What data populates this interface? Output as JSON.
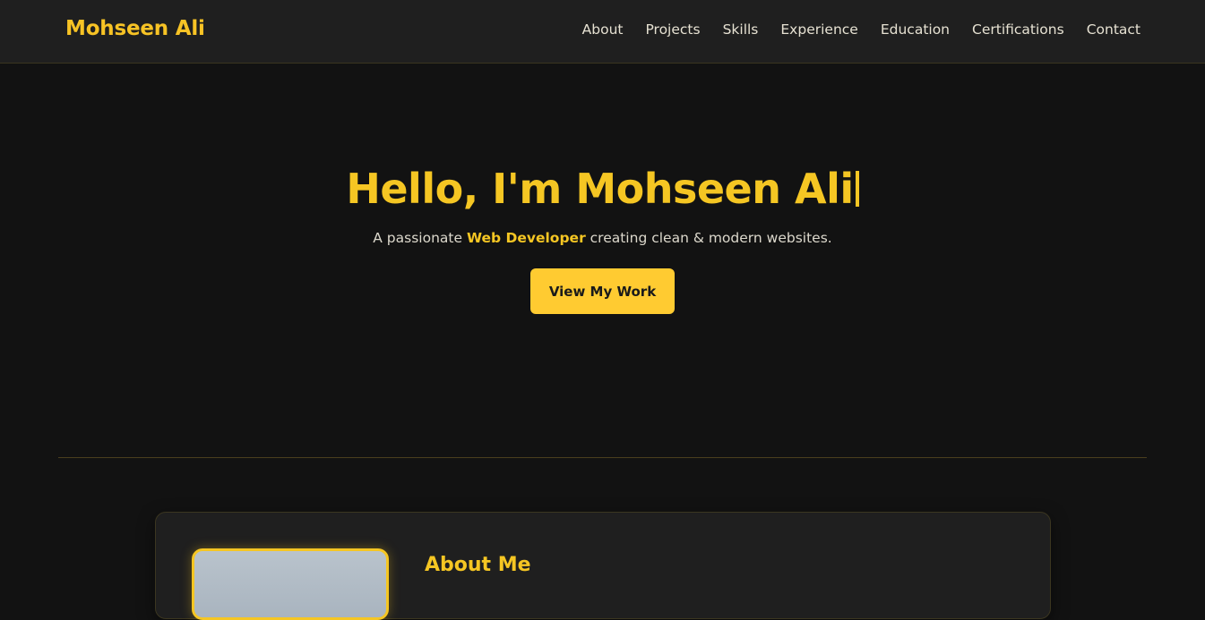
{
  "navbar": {
    "brand": "Mohseen Ali",
    "links": [
      {
        "label": "About"
      },
      {
        "label": "Projects"
      },
      {
        "label": "Skills"
      },
      {
        "label": "Experience"
      },
      {
        "label": "Education"
      },
      {
        "label": "Certifications"
      },
      {
        "label": "Contact"
      }
    ]
  },
  "hero": {
    "title": "Hello, I'm Mohseen Ali",
    "subtitle_prefix": "A passionate ",
    "subtitle_highlight": "Web Developer",
    "subtitle_suffix": " creating clean & modern websites.",
    "cta_label": "View My Work"
  },
  "about": {
    "title": "About Me"
  },
  "colors": {
    "accent": "#f5c623",
    "background": "#121212",
    "navbar_bg": "#1f1f1f",
    "button_bg": "#ffcb31"
  }
}
